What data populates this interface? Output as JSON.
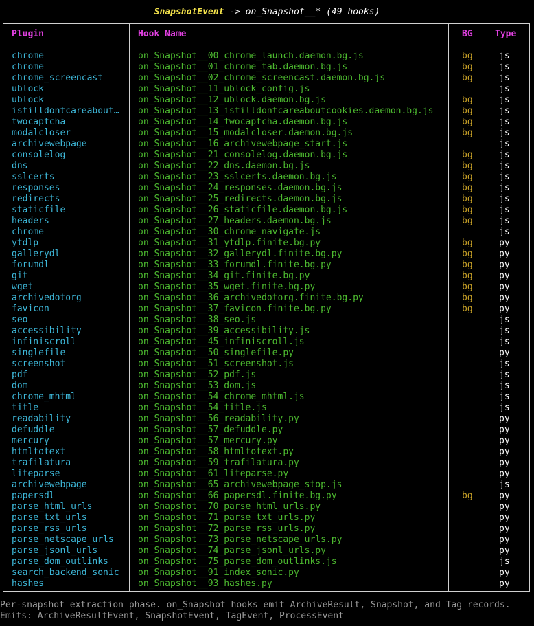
{
  "title": {
    "event": "SnapshotEvent",
    "rest": " -> on_Snapshot__* (49 hooks)"
  },
  "columns": {
    "plugin": "Plugin",
    "hook": "Hook Name",
    "bg": "BG",
    "type": "Type"
  },
  "rows": [
    {
      "plugin": "chrome",
      "hook": "on_Snapshot__00_chrome_launch.daemon.bg.js",
      "bg": "bg",
      "type": "js"
    },
    {
      "plugin": "chrome",
      "hook": "on_Snapshot__01_chrome_tab.daemon.bg.js",
      "bg": "bg",
      "type": "js"
    },
    {
      "plugin": "chrome_screencast",
      "hook": "on_Snapshot__02_chrome_screencast.daemon.bg.js",
      "bg": "bg",
      "type": "js"
    },
    {
      "plugin": "ublock",
      "hook": "on_Snapshot__11_ublock_config.js",
      "bg": "",
      "type": "js"
    },
    {
      "plugin": "ublock",
      "hook": "on_Snapshot__12_ublock.daemon.bg.js",
      "bg": "bg",
      "type": "js"
    },
    {
      "plugin": "istilldontcareabout…",
      "hook": "on_Snapshot__13_istilldontcareaboutcookies.daemon.bg.js",
      "bg": "bg",
      "type": "js"
    },
    {
      "plugin": "twocaptcha",
      "hook": "on_Snapshot__14_twocaptcha.daemon.bg.js",
      "bg": "bg",
      "type": "js"
    },
    {
      "plugin": "modalcloser",
      "hook": "on_Snapshot__15_modalcloser.daemon.bg.js",
      "bg": "bg",
      "type": "js"
    },
    {
      "plugin": "archivewebpage",
      "hook": "on_Snapshot__16_archivewebpage_start.js",
      "bg": "",
      "type": "js"
    },
    {
      "plugin": "consolelog",
      "hook": "on_Snapshot__21_consolelog.daemon.bg.js",
      "bg": "bg",
      "type": "js"
    },
    {
      "plugin": "dns",
      "hook": "on_Snapshot__22_dns.daemon.bg.js",
      "bg": "bg",
      "type": "js"
    },
    {
      "plugin": "sslcerts",
      "hook": "on_Snapshot__23_sslcerts.daemon.bg.js",
      "bg": "bg",
      "type": "js"
    },
    {
      "plugin": "responses",
      "hook": "on_Snapshot__24_responses.daemon.bg.js",
      "bg": "bg",
      "type": "js"
    },
    {
      "plugin": "redirects",
      "hook": "on_Snapshot__25_redirects.daemon.bg.js",
      "bg": "bg",
      "type": "js"
    },
    {
      "plugin": "staticfile",
      "hook": "on_Snapshot__26_staticfile.daemon.bg.js",
      "bg": "bg",
      "type": "js"
    },
    {
      "plugin": "headers",
      "hook": "on_Snapshot__27_headers.daemon.bg.js",
      "bg": "bg",
      "type": "js"
    },
    {
      "plugin": "chrome",
      "hook": "on_Snapshot__30_chrome_navigate.js",
      "bg": "",
      "type": "js"
    },
    {
      "plugin": "ytdlp",
      "hook": "on_Snapshot__31_ytdlp.finite.bg.py",
      "bg": "bg",
      "type": "py"
    },
    {
      "plugin": "gallerydl",
      "hook": "on_Snapshot__32_gallerydl.finite.bg.py",
      "bg": "bg",
      "type": "py"
    },
    {
      "plugin": "forumdl",
      "hook": "on_Snapshot__33_forumdl.finite.bg.py",
      "bg": "bg",
      "type": "py"
    },
    {
      "plugin": "git",
      "hook": "on_Snapshot__34_git.finite.bg.py",
      "bg": "bg",
      "type": "py"
    },
    {
      "plugin": "wget",
      "hook": "on_Snapshot__35_wget.finite.bg.py",
      "bg": "bg",
      "type": "py"
    },
    {
      "plugin": "archivedotorg",
      "hook": "on_Snapshot__36_archivedotorg.finite.bg.py",
      "bg": "bg",
      "type": "py"
    },
    {
      "plugin": "favicon",
      "hook": "on_Snapshot__37_favicon.finite.bg.py",
      "bg": "bg",
      "type": "py"
    },
    {
      "plugin": "seo",
      "hook": "on_Snapshot__38_seo.js",
      "bg": "",
      "type": "js"
    },
    {
      "plugin": "accessibility",
      "hook": "on_Snapshot__39_accessibility.js",
      "bg": "",
      "type": "js"
    },
    {
      "plugin": "infiniscroll",
      "hook": "on_Snapshot__45_infiniscroll.js",
      "bg": "",
      "type": "js"
    },
    {
      "plugin": "singlefile",
      "hook": "on_Snapshot__50_singlefile.py",
      "bg": "",
      "type": "py"
    },
    {
      "plugin": "screenshot",
      "hook": "on_Snapshot__51_screenshot.js",
      "bg": "",
      "type": "js"
    },
    {
      "plugin": "pdf",
      "hook": "on_Snapshot__52_pdf.js",
      "bg": "",
      "type": "js"
    },
    {
      "plugin": "dom",
      "hook": "on_Snapshot__53_dom.js",
      "bg": "",
      "type": "js"
    },
    {
      "plugin": "chrome_mhtml",
      "hook": "on_Snapshot__54_chrome_mhtml.js",
      "bg": "",
      "type": "js"
    },
    {
      "plugin": "title",
      "hook": "on_Snapshot__54_title.js",
      "bg": "",
      "type": "js"
    },
    {
      "plugin": "readability",
      "hook": "on_Snapshot__56_readability.py",
      "bg": "",
      "type": "py"
    },
    {
      "plugin": "defuddle",
      "hook": "on_Snapshot__57_defuddle.py",
      "bg": "",
      "type": "py"
    },
    {
      "plugin": "mercury",
      "hook": "on_Snapshot__57_mercury.py",
      "bg": "",
      "type": "py"
    },
    {
      "plugin": "htmltotext",
      "hook": "on_Snapshot__58_htmltotext.py",
      "bg": "",
      "type": "py"
    },
    {
      "plugin": "trafilatura",
      "hook": "on_Snapshot__59_trafilatura.py",
      "bg": "",
      "type": "py"
    },
    {
      "plugin": "liteparse",
      "hook": "on_Snapshot__61_liteparse.py",
      "bg": "",
      "type": "py"
    },
    {
      "plugin": "archivewebpage",
      "hook": "on_Snapshot__65_archivewebpage_stop.js",
      "bg": "",
      "type": "js"
    },
    {
      "plugin": "papersdl",
      "hook": "on_Snapshot__66_papersdl.finite.bg.py",
      "bg": "bg",
      "type": "py"
    },
    {
      "plugin": "parse_html_urls",
      "hook": "on_Snapshot__70_parse_html_urls.py",
      "bg": "",
      "type": "py"
    },
    {
      "plugin": "parse_txt_urls",
      "hook": "on_Snapshot__71_parse_txt_urls.py",
      "bg": "",
      "type": "py"
    },
    {
      "plugin": "parse_rss_urls",
      "hook": "on_Snapshot__72_parse_rss_urls.py",
      "bg": "",
      "type": "py"
    },
    {
      "plugin": "parse_netscape_urls",
      "hook": "on_Snapshot__73_parse_netscape_urls.py",
      "bg": "",
      "type": "py"
    },
    {
      "plugin": "parse_jsonl_urls",
      "hook": "on_Snapshot__74_parse_jsonl_urls.py",
      "bg": "",
      "type": "py"
    },
    {
      "plugin": "parse_dom_outlinks",
      "hook": "on_Snapshot__75_parse_dom_outlinks.js",
      "bg": "",
      "type": "js"
    },
    {
      "plugin": "search_backend_sonic",
      "hook": "on_Snapshot__91_index_sonic.py",
      "bg": "",
      "type": "py"
    },
    {
      "plugin": "hashes",
      "hook": "on_Snapshot__93_hashes.py",
      "bg": "",
      "type": "py"
    }
  ],
  "footer": {
    "line1": "Per-snapshot extraction phase. on_Snapshot hooks emit ArchiveResult, Snapshot, and Tag records.",
    "line2": "Emits: ArchiveResultEvent, SnapshotEvent, TagEvent, ProcessEvent"
  },
  "colors": {
    "header": "#e040e0",
    "plugin": "#3db7d8",
    "hook": "#4cb82f",
    "bg": "#c9a227",
    "title_event": "#f2e14b"
  }
}
